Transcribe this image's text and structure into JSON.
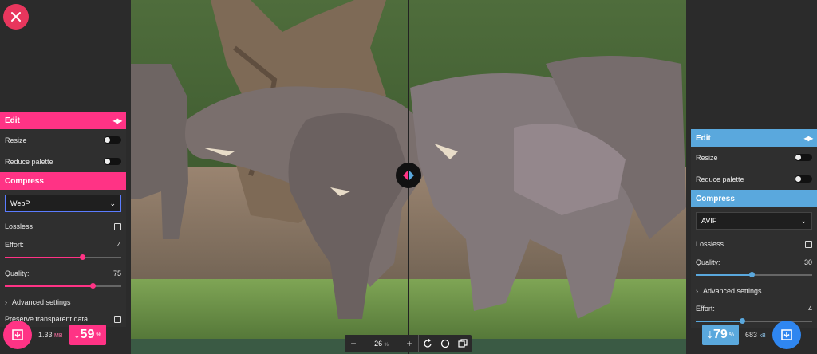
{
  "colors": {
    "pink": "#ff3385",
    "blue": "#5aa8dd",
    "panel": "#2f2f2f"
  },
  "left_panel": {
    "edit_title": "Edit",
    "resize_label": "Resize",
    "reduce_palette_label": "Reduce palette",
    "compress_title": "Compress",
    "format": "WebP",
    "lossless_label": "Lossless",
    "effort_label": "Effort:",
    "effort_value": "4",
    "effort_fraction": 0.6667,
    "quality_label": "Quality:",
    "quality_value": "75",
    "quality_fraction": 0.75,
    "advanced_label": "Advanced settings",
    "preserve_label": "Preserve transparent data",
    "size_value": "1.33",
    "size_unit": "MB",
    "percent": "↓59",
    "percent_unit": "%"
  },
  "right_panel": {
    "edit_title": "Edit",
    "resize_label": "Resize",
    "reduce_palette_label": "Reduce palette",
    "compress_title": "Compress",
    "format": "AVIF",
    "lossless_label": "Lossless",
    "quality_label": "Quality:",
    "quality_value": "30",
    "quality_fraction": 0.4762,
    "advanced_label": "Advanced settings",
    "effort_label": "Effort:",
    "effort_value": "4",
    "effort_fraction": 0.4,
    "percent": "↓79",
    "percent_unit": "%",
    "size_value": "683",
    "size_unit": "kB"
  },
  "zoom": {
    "minus": "−",
    "value": "26",
    "unit": "%",
    "plus": "+"
  },
  "icons": {
    "close": "close-icon",
    "download": "download-icon",
    "rotate": "rotate-icon",
    "background": "background-toggle-icon",
    "side_by_side": "side-by-side-icon",
    "arrows": "arrows-icon"
  }
}
